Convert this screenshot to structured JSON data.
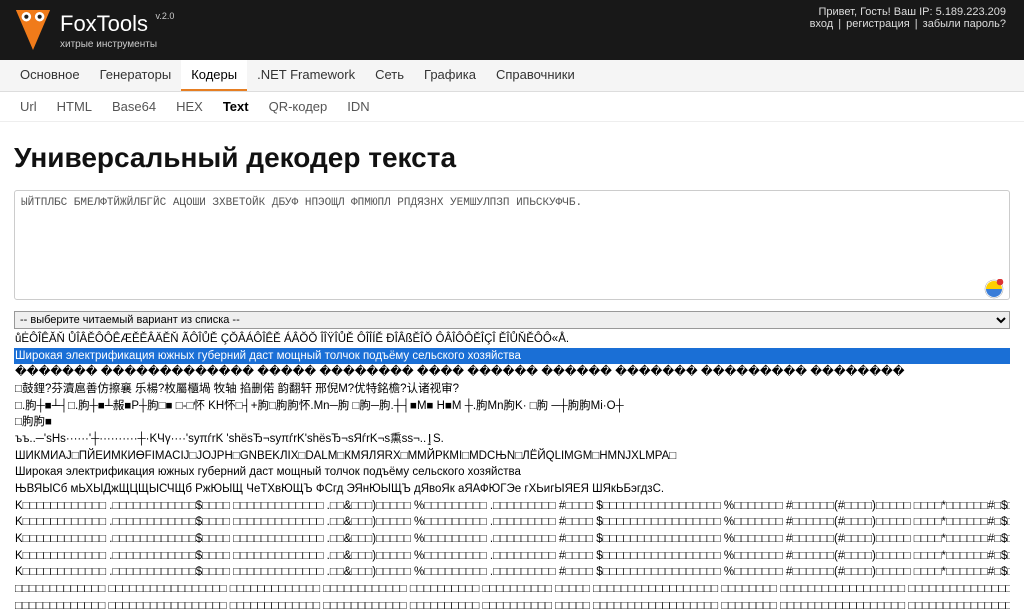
{
  "header": {
    "brand": "FoxTools",
    "version": "v.2.0",
    "tagline": "хитрые инструменты",
    "greeting_prefix": "Привет, Гость! Ваш IP: ",
    "ip": "5.189.223.209",
    "login": "вход",
    "register": "регистрация",
    "forgot": "забыли пароль?"
  },
  "nav_main": {
    "items": [
      "Основное",
      "Генераторы",
      "Кодеры",
      ".NET Framework",
      "Сеть",
      "Графика",
      "Справочники"
    ],
    "active": "Кодеры"
  },
  "nav_sub": {
    "items": [
      "Url",
      "HTML",
      "Base64",
      "HEX",
      "Text",
      "QR-кодер",
      "IDN"
    ],
    "active": "Text"
  },
  "page": {
    "title": "Универсальный декодер текста",
    "textarea_value": "ЫЙТПЛБС БМЕЛФТЙЖЙЛБГЙС АЦОШИ ЗХВЕТОЙК ДБУФ НПЭОЩЛ ФПМЮПЛ РПДЯЗНХ УЕМШУЛПЗП ИПЬСКУФЧБ.",
    "select_placeholder": "-- выберите читаемый вариант из списка --"
  },
  "decoded": [
    {
      "text": "ůĖÔÎÊĂŇ ŮÎÂĚÔÔÊÆĚĚÂÄĚŇ ÃÔÎŮĚ ÇŎÂÁÔÎÊĚ ÁÂŎŎ ÎÎŸÎŮĚ ÔÎÎÍĚ ĐÎÂßĚÎŎ ÔÂÎÔÔĚÎÇÎ ĚÎŮŇĚÔÔ«Å."
    },
    {
      "text": "Широкая электрификация южных губерний даст мощный толчок подъёму сельского хозяйства",
      "highlight": true
    },
    {
      "text": "������� ������������� ����� �������� ���� ������ ������ ������� ��������� ��������"
    },
    {
      "text": "□鼓鋰?芬瀆扈善仿擦襄 乐楊?枚屬櫃堝 牧轴 掐删偌 韵翻轩 邢倪M?优特銘檐?认诸视审?"
    },
    {
      "text": "□.朐┼■┴┤□.朐┼■┴赧■P┼朐□■ □-□怀 KH怀□┤+朐□朐朐怀.Mn─朐 □朐─朐.┼┤■M■ H■M ┼.朐Mn朐K· □朐 ─┼朐朐Mi·O┼"
    },
    {
      "text": "□朐朐■"
    },
    {
      "text": "ъъ..─'ѕНѕ······'┼··········┼·KЧγ····'ѕуπѓrK 'ѕhёѕЂ¬ѕуπѓrK'ѕhёѕЂ¬ѕЯѓrK¬ѕ熏sѕ¬..ٳS."
    },
    {
      "text": "ШИКМИАЈ□ПЙЕИМКИӨFIMACIЈ□ЈОЈРН□GNBEKЛIX□DALM□КМЯЛЯRХ□ММЙРКМI□MDCЊN□ЛЁЙQLIMGM□HMNJXLMPA□"
    },
    {
      "text": "Широкая электрификация южных губерний даст мощный толчок подъёму сельского хозяйства"
    },
    {
      "text": "ЊВЯЫСб мЬХЫДжЩЦЩЫСЧЩб РжЮЫЩ ЧеТХвЮЩЪ ФСгд ЭЯнЮЫЩЪ дЯвоЯк аЯАФЮГЭе гХЬигЫЯЕЯ ШЯкЬБэгдзС."
    },
    {
      "text": "K□□□□□□□□□□□□ .□□□□□□□□□□□□$□□□□  □□□□□□□□□□□□□ .□□&□□□)□□□□□ %□□□□□□□□□ .□□□□□□□□□ #□□□□ $□□□□□□□□□□□□□□□□□ %□□□□□□□ #□□□□□□(#□□□□)□□□□□ □□□□*□□□□□□#□$□□□."
    },
    {
      "text": "K□□□□□□□□□□□□ .□□□□□□□□□□□□$□□□□  □□□□□□□□□□□□□ .□□&□□□)□□□□□ %□□□□□□□□□ .□□□□□□□□□ #□□□□ $□□□□□□□□□□□□□□□□□ %□□□□□□□ #□□□□□□(#□□□□)□□□□□ □□□□*□□□□□□#□$□□□."
    },
    {
      "text": "K□□□□□□□□□□□□ .□□□□□□□□□□□□$□□□□  □□□□□□□□□□□□□ .□□&□□□)□□□□□ %□□□□□□□□□ .□□□□□□□□□ #□□□□ $□□□□□□□□□□□□□□□□□ %□□□□□□□ #□□□□□□(#□□□□)□□□□□ □□□□*□□□□□□#□$□□□."
    },
    {
      "text": "K□□□□□□□□□□□□ .□□□□□□□□□□□□$□□□□  □□□□□□□□□□□□□ .□□&□□□)□□□□□ %□□□□□□□□□ .□□□□□□□□□ #□□□□ $□□□□□□□□□□□□□□□□□ %□□□□□□□ #□□□□□□(#□□□□)□□□□□ □□□□*□□□□□□#□$□□□."
    },
    {
      "text": "K□□□□□□□□□□□□ .□□□□□□□□□□□□$□□□□  □□□□□□□□□□□□□ .□□&□□□)□□□□□ %□□□□□□□□□ .□□□□□□□□□ #□□□□ $□□□□□□□□□□□□□□□□□ %□□□□□□□ #□□□□□□(#□□□□)□□□□□ □□□□*□□□□□□#□$□□□."
    },
    {
      "text": "□□□□□□□□□□□□□ □□□□□□□□□□□□□□□□□  □□□□□□□□□□□□□ □□□□□□□□□□□□ □□□□□□□□□□ □□□□□□□□□□ □□□□□ □□□□□□□□□□□□□□□□□□ □□□□□□□□ □□□□□□□□□□□□□□□□□□ □□□□□□□□□□□□□□□□."
    },
    {
      "text": "□□□□□□□□□□□□□ □□□□□□□□□□□□□□□□□  □□□□□□□□□□□□□ □□□□□□□□□□□□ □□□□□□□□□□ □□□□□□□□□□ □□□□□ □□□□□□□□□□□□□□□□□□ □□□□□□□□ □□□□□□□□□□□□□□□□□□ □□□□□□□□□□□□□□□□."
    }
  ]
}
